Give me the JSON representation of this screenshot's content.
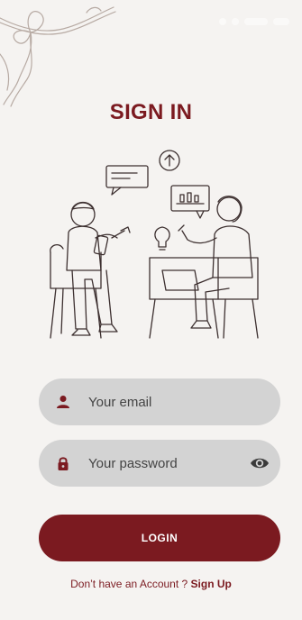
{
  "screen": {
    "title": "SIGN IN"
  },
  "form": {
    "email": {
      "placeholder": "Your email",
      "value": "",
      "icon": "person-icon"
    },
    "password": {
      "placeholder": "Your password",
      "value": "",
      "icon": "lock-icon",
      "toggle_icon": "eye-icon"
    },
    "login_label": "LOGIN"
  },
  "signup": {
    "prompt": "Don’t have an Account ?",
    "link_label": "Sign Up"
  },
  "colors": {
    "primary": "#7b1a20",
    "background": "#f5f3f1",
    "field_background": "#d3d3d3"
  }
}
